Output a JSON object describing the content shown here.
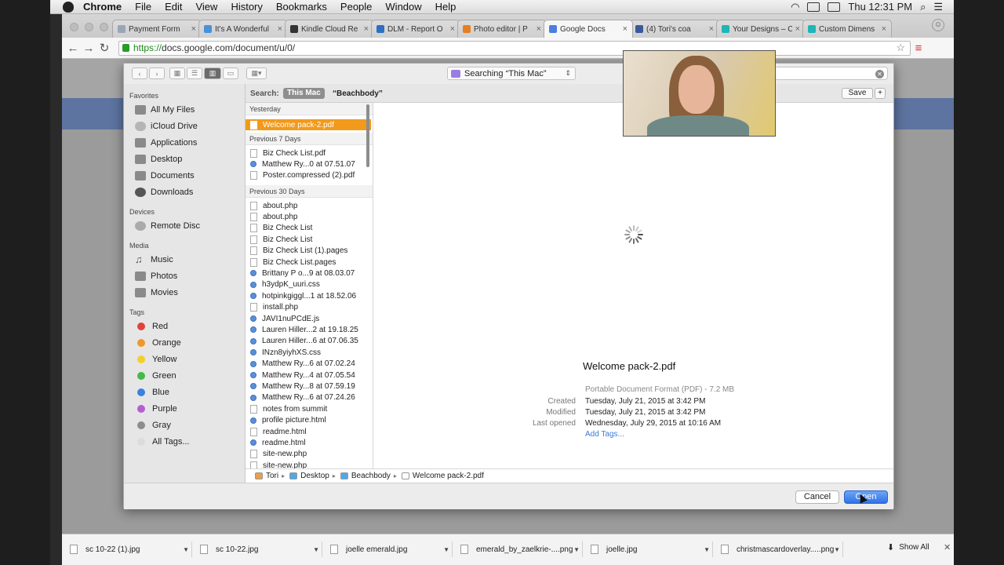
{
  "menubar": {
    "items": [
      "Chrome",
      "File",
      "Edit",
      "View",
      "History",
      "Bookmarks",
      "People",
      "Window",
      "Help"
    ],
    "clock": "Thu 12:31 PM"
  },
  "tabs": [
    {
      "label": "Payment Form",
      "color": "#9aa6b8"
    },
    {
      "label": "It's A Wonderful",
      "color": "#4a90d9"
    },
    {
      "label": "Kindle Cloud Re",
      "color": "#333333"
    },
    {
      "label": "DLM - Report O",
      "color": "#2d6fc2"
    },
    {
      "label": "Photo editor | P",
      "color": "#e67e22"
    },
    {
      "label": "Google Docs",
      "color": "#4a7fe0"
    },
    {
      "label": "(4) Tori's coa",
      "color": "#3b5998"
    },
    {
      "label": "Your Designs – C",
      "color": "#1fb6b6"
    },
    {
      "label": "Custom Dimens",
      "color": "#1fb6b6"
    }
  ],
  "active_tab_index": 5,
  "address": {
    "protocol": "https://",
    "rest": "docs.google.com/document/u/0/"
  },
  "dialog": {
    "location": "Searching “This Mac”",
    "search": {
      "label": "Search:",
      "scope": "This Mac",
      "term": "“Beachbody”",
      "save": "Save",
      "plus": "+"
    },
    "sidebar": {
      "favorites_header": "Favorites",
      "favorites": [
        "All My Files",
        "iCloud Drive",
        "Applications",
        "Desktop",
        "Documents",
        "Downloads"
      ],
      "devices_header": "Devices",
      "devices": [
        "Remote Disc"
      ],
      "media_header": "Media",
      "media": [
        "Music",
        "Photos",
        "Movies"
      ],
      "tags_header": "Tags",
      "tags": [
        {
          "label": "Red",
          "color": "#e0433b"
        },
        {
          "label": "Orange",
          "color": "#f0962a"
        },
        {
          "label": "Yellow",
          "color": "#f2cf2c"
        },
        {
          "label": "Green",
          "color": "#45b94a"
        },
        {
          "label": "Blue",
          "color": "#3b82e0"
        },
        {
          "label": "Purple",
          "color": "#b55fcf"
        },
        {
          "label": "Gray",
          "color": "#8d8d8d"
        },
        {
          "label": "All Tags...",
          "color": "#dcdcdc"
        }
      ]
    },
    "groups": {
      "yesterday": "Yesterday",
      "previous7": "Previous 7 Days",
      "previous30": "Previous 30 Days"
    },
    "files_yesterday": [
      {
        "name": "Welcome pack-2.pdf",
        "blue": false
      }
    ],
    "files_7": [
      {
        "name": "Biz Check List.pdf",
        "blue": false
      },
      {
        "name": "Matthew Ry...0 at 07.51.07",
        "blue": true
      },
      {
        "name": "Poster.compressed (2).pdf",
        "blue": false
      }
    ],
    "files_30": [
      {
        "name": "about.php",
        "blue": false
      },
      {
        "name": "about.php",
        "blue": false
      },
      {
        "name": "Biz Check List",
        "blue": false
      },
      {
        "name": "Biz Check List",
        "blue": false
      },
      {
        "name": "Biz Check List (1).pages",
        "blue": false
      },
      {
        "name": "Biz Check List.pages",
        "blue": false
      },
      {
        "name": "Brittany P o...9 at 08.03.07",
        "blue": true
      },
      {
        "name": "h3ydpK_uuri.css",
        "blue": true
      },
      {
        "name": "hotpinkgiggl...1 at 18.52.06",
        "blue": true
      },
      {
        "name": "install.php",
        "blue": false
      },
      {
        "name": "JAVI1nuPCdE.js",
        "blue": true
      },
      {
        "name": "Lauren Hiller...2 at 19.18.25",
        "blue": true
      },
      {
        "name": "Lauren Hiller...6 at 07.06.35",
        "blue": true
      },
      {
        "name": "INzn8yiyhXS.css",
        "blue": true
      },
      {
        "name": "Matthew Ry...6 at 07.02.24",
        "blue": true
      },
      {
        "name": "Matthew Ry...4 at 07.05.54",
        "blue": true
      },
      {
        "name": "Matthew Ry...8 at 07.59.19",
        "blue": true
      },
      {
        "name": "Matthew Ry...6 at 07.24.26",
        "blue": true
      },
      {
        "name": "notes from summit",
        "blue": false
      },
      {
        "name": "profile picture.html",
        "blue": true
      },
      {
        "name": "readme.html",
        "blue": false
      },
      {
        "name": "readme.html",
        "blue": true
      },
      {
        "name": "site-new.php",
        "blue": false
      },
      {
        "name": "site-new.php",
        "blue": false
      }
    ],
    "preview": {
      "name": "Welcome pack-2.pdf",
      "kind": "Portable Document Format (PDF) - 7.2 MB",
      "rows": [
        {
          "k": "Created",
          "v": "Tuesday, July 21, 2015 at 3:42 PM"
        },
        {
          "k": "Modified",
          "v": "Tuesday, July 21, 2015 at 3:42 PM"
        },
        {
          "k": "Last opened",
          "v": "Wednesday, July 29, 2015 at 10:16 AM"
        }
      ],
      "add_tags": "Add Tags..."
    },
    "path": [
      {
        "label": "Tori",
        "color": "#e8a04a"
      },
      {
        "label": "Desktop",
        "color": "#4fa9e6"
      },
      {
        "label": "Beachbody",
        "color": "#4fa9e6"
      },
      {
        "label": "Welcome pack-2.pdf",
        "color": "#ffffff"
      }
    ],
    "cancel": "Cancel",
    "open": "Open"
  },
  "downloads": {
    "items": [
      "sc 10-22 (1).jpg",
      "sc 10-22.jpg",
      "joelle emerald.jpg",
      "emerald_by_zaelkrie-....png",
      "joelle.jpg",
      "christmascardoverlay.....png"
    ],
    "show_all": "Show All"
  }
}
